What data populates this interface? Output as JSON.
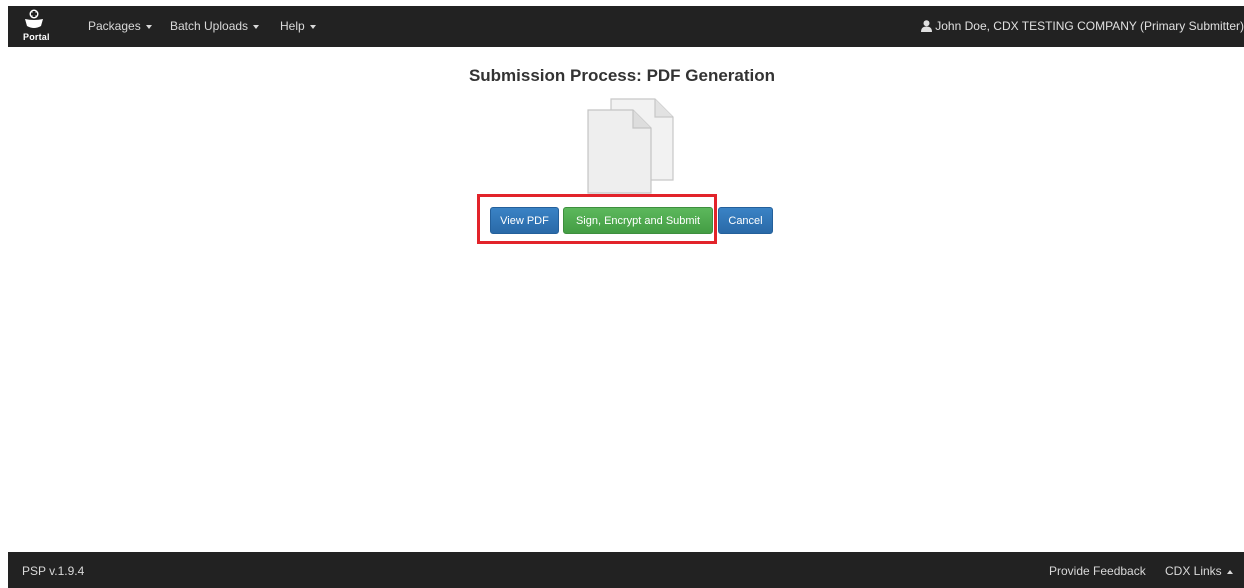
{
  "navbar": {
    "brand_text": "Portal",
    "menu": [
      {
        "label": "Packages"
      },
      {
        "label": "Batch Uploads"
      },
      {
        "label": "Help"
      }
    ],
    "user": "John Doe, CDX TESTING COMPANY (Primary Submitter)"
  },
  "main": {
    "title": "Submission Process: PDF Generation",
    "buttons": {
      "view_pdf": "View PDF",
      "sign_submit": "Sign, Encrypt and Submit",
      "cancel": "Cancel"
    },
    "highlight_color": "#e2232a",
    "icons": [
      "documents-icon"
    ]
  },
  "footer": {
    "version": "PSP  v.1.9.4",
    "feedback": "Provide Feedback",
    "cdx_links": "CDX Links"
  },
  "colors": {
    "navbar_bg": "#222222",
    "primary": "#2a6aa8",
    "success": "#449d44"
  }
}
